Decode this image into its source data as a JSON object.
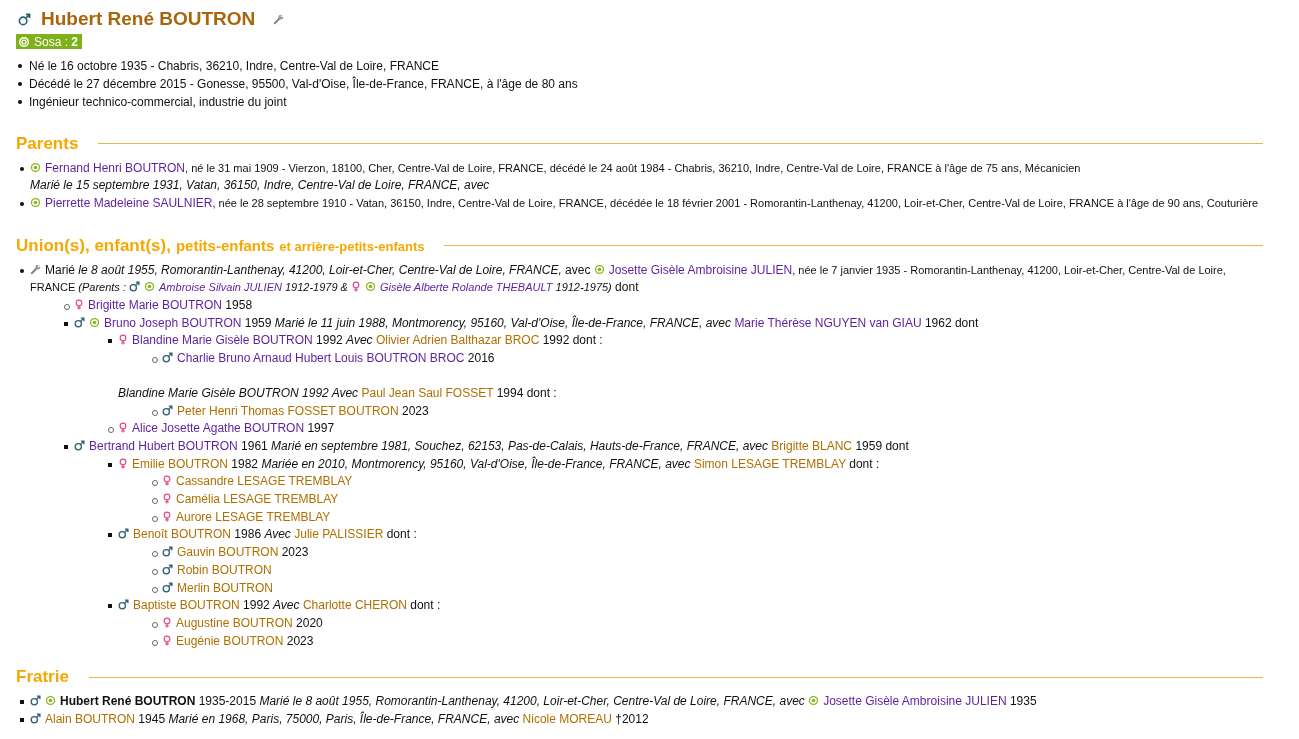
{
  "person": {
    "title": [
      {
        "kind": "male"
      },
      {
        "kind": "name",
        "text": "Hubert René BOUTRON"
      },
      {
        "kind": "tool"
      }
    ],
    "sosa": "Sosa : **2**",
    "facts": [
      "Né le 16 octobre 1935 - Chabris, 36210, Indre, Centre-Val de Loire, FRANCE",
      "Décédé le 27 décembre 2015 - Gonesse, 95500, Val-d'Oise, Île-de-France, FRANCE, à l'âge de 80 ans",
      "Ingénieur technico-commercial, industrie du joint"
    ]
  },
  "sections": [
    {
      "title_parts": [
        "Parents"
      ],
      "items": [
        {
          "kind": "disc",
          "segments": [
            {
              "kind": "sosa"
            },
            {
              "kind": "link",
              "text": "Fernand Henri BOUTRON"
            },
            {
              "kind": "detail",
              "text": ", né le 31 mai 1909 - Vierzon, 18100, Cher, Centre-Val de Loire, FRANCE, décédé le 24 août 1984 - Chabris, 36210, Indre, Centre-Val de Loire, FRANCE à l'âge de 75 ans, Mécanicien"
            }
          ],
          "blocks": [
            {
              "kind": "line",
              "segments": [
                {
                  "kind": "italic",
                  "text": "Marié le 15 septembre 1931, Vatan, 36150, Indre, Centre-Val de Loire, FRANCE, avec"
                }
              ]
            }
          ]
        },
        {
          "kind": "disc",
          "segments": [
            {
              "kind": "sosa"
            },
            {
              "kind": "link",
              "text": "Pierrette Madeleine SAULNIER"
            },
            {
              "kind": "detail",
              "text": ", née le 28 septembre 1910 - Vatan, 36150, Indre, Centre-Val de Loire, FRANCE, décédée le 18 février 2001 - Romorantin-Lanthenay, 41200, Loir-et-Cher, Centre-Val de Loire, FRANCE à l'âge de 90 ans, Couturière"
            }
          ]
        }
      ]
    },
    {
      "title_parts": [
        "Union(s), enfant(s),",
        "petits-enfants",
        "et arrière-petits-enfants"
      ],
      "items": [
        {
          "kind": "disc",
          "segments": [
            {
              "kind": "tool"
            },
            {
              "kind": "text",
              "text": "Marié"
            },
            {
              "kind": "italic",
              "text": " le 8 août 1955, Romorantin-Lanthenay, 41200, Loir-et-Cher, Centre-Val de Loire, FRANCE,"
            },
            {
              "kind": "text",
              "text": " avec "
            },
            {
              "kind": "sosa"
            },
            {
              "kind": "link",
              "text": "Josette Gisèle Ambroisine JULIEN"
            },
            {
              "kind": "detail",
              "text": ", née le 7 janvier 1935 - Romorantin-Lanthenay, 41200, Loir-et-Cher, Centre-Val de Loire,"
            }
          ],
          "blocks": [
            {
              "kind": "line",
              "segments": [
                {
                  "kind": "detail",
                  "text": "FRANCE"
                },
                {
                  "kind": "sitalic",
                  "text": " (Parents : "
                },
                {
                  "kind": "male"
                },
                {
                  "kind": "sosa"
                },
                {
                  "kind": "ilink",
                  "text": "Ambroise Silvain JULIEN"
                },
                {
                  "kind": "sitalic",
                  "text": " 1912-1979 & "
                },
                {
                  "kind": "female"
                },
                {
                  "kind": "sosa"
                },
                {
                  "kind": "ilink",
                  "text": "Gisèle Alberte Rolande THEBAULT"
                },
                {
                  "kind": "sitalic",
                  "text": " 1912-1975)"
                },
                {
                  "kind": "text",
                  "text": " dont"
                }
              ]
            },
            {
              "kind": "list",
              "children": [
                {
                  "kind": "circle",
                  "segments": [
                    {
                      "kind": "female"
                    },
                    {
                      "kind": "link",
                      "text": "Brigitte Marie BOUTRON"
                    },
                    {
                      "kind": "text",
                      "text": " 1958"
                    }
                  ]
                },
                {
                  "kind": "square",
                  "segments": [
                    {
                      "kind": "male"
                    },
                    {
                      "kind": "sosa"
                    },
                    {
                      "kind": "link",
                      "text": "Bruno Joseph BOUTRON"
                    },
                    {
                      "kind": "text",
                      "text": " 1959 "
                    },
                    {
                      "kind": "italic",
                      "text": " Marié le 11 juin 1988, Montmorency, 95160, Val-d'Oise, Île-de-France, FRANCE, avec "
                    },
                    {
                      "kind": "link",
                      "text": "Marie Thérèse NGUYEN van GIAU"
                    },
                    {
                      "kind": "text",
                      "text": " 1962 dont"
                    }
                  ],
                  "blocks": [
                    {
                      "kind": "list",
                      "children": [
                        {
                          "kind": "square",
                          "segments": [
                            {
                              "kind": "female"
                            },
                            {
                              "kind": "link",
                              "text": "Blandine Marie Gisèle BOUTRON"
                            },
                            {
                              "kind": "text",
                              "text": " 1992 "
                            },
                            {
                              "kind": "italic",
                              "text": "Avec "
                            },
                            {
                              "kind": "alink",
                              "text": "Olivier Adrien Balthazar BROC"
                            },
                            {
                              "kind": "text",
                              "text": " 1992 dont :"
                            }
                          ],
                          "blocks": [
                            {
                              "kind": "list",
                              "children": [
                                {
                                  "kind": "circle",
                                  "segments": [
                                    {
                                      "kind": "male"
                                    },
                                    {
                                      "kind": "link",
                                      "text": "Charlie Bruno Arnaud Hubert Louis BOUTRON BROC"
                                    },
                                    {
                                      "kind": "text",
                                      "text": " 2016"
                                    }
                                  ]
                                }
                              ]
                            },
                            {
                              "kind": "gap"
                            },
                            {
                              "kind": "line",
                              "segments": [
                                {
                                  "kind": "italic",
                                  "text": "Blandine Marie Gisèle BOUTRON 1992  Avec "
                                },
                                {
                                  "kind": "alink",
                                  "text": "Paul Jean Saul FOSSET"
                                },
                                {
                                  "kind": "text",
                                  "text": " 1994 dont :"
                                }
                              ]
                            },
                            {
                              "kind": "list",
                              "children": [
                                {
                                  "kind": "circle",
                                  "segments": [
                                    {
                                      "kind": "male"
                                    },
                                    {
                                      "kind": "alink",
                                      "text": "Peter Henri Thomas FOSSET BOUTRON"
                                    },
                                    {
                                      "kind": "text",
                                      "text": " 2023"
                                    }
                                  ]
                                }
                              ]
                            }
                          ]
                        },
                        {
                          "kind": "circle",
                          "segments": [
                            {
                              "kind": "female"
                            },
                            {
                              "kind": "link",
                              "text": "Alice Josette Agathe BOUTRON"
                            },
                            {
                              "kind": "text",
                              "text": " 1997"
                            }
                          ]
                        }
                      ]
                    }
                  ]
                },
                {
                  "kind": "square",
                  "segments": [
                    {
                      "kind": "male"
                    },
                    {
                      "kind": "link",
                      "text": "Bertrand Hubert BOUTRON"
                    },
                    {
                      "kind": "text",
                      "text": " 1961 "
                    },
                    {
                      "kind": "italic",
                      "text": " Marié en septembre 1981, Souchez, 62153, Pas-de-Calais, Hauts-de-France, FRANCE, avec "
                    },
                    {
                      "kind": "alink",
                      "text": "Brigitte BLANC"
                    },
                    {
                      "kind": "text",
                      "text": " 1959 dont"
                    }
                  ],
                  "blocks": [
                    {
                      "kind": "list",
                      "children": [
                        {
                          "kind": "square",
                          "segments": [
                            {
                              "kind": "female"
                            },
                            {
                              "kind": "alink",
                              "text": "Emilie BOUTRON"
                            },
                            {
                              "kind": "text",
                              "text": " 1982 "
                            },
                            {
                              "kind": "italic",
                              "text": "Mariée en 2010, Montmorency, 95160, Val-d'Oise, Île-de-France, FRANCE, avec "
                            },
                            {
                              "kind": "alink",
                              "text": "Simon LESAGE TREMBLAY"
                            },
                            {
                              "kind": "text",
                              "text": " dont :"
                            }
                          ],
                          "blocks": [
                            {
                              "kind": "list",
                              "children": [
                                {
                                  "kind": "circle",
                                  "segments": [
                                    {
                                      "kind": "female"
                                    },
                                    {
                                      "kind": "alink",
                                      "text": "Cassandre LESAGE TREMBLAY"
                                    }
                                  ]
                                },
                                {
                                  "kind": "circle",
                                  "segments": [
                                    {
                                      "kind": "female"
                                    },
                                    {
                                      "kind": "alink",
                                      "text": "Camélia LESAGE TREMBLAY"
                                    }
                                  ]
                                },
                                {
                                  "kind": "circle",
                                  "segments": [
                                    {
                                      "kind": "female"
                                    },
                                    {
                                      "kind": "alink",
                                      "text": "Aurore LESAGE TREMBLAY"
                                    }
                                  ]
                                }
                              ]
                            }
                          ]
                        },
                        {
                          "kind": "square",
                          "segments": [
                            {
                              "kind": "male"
                            },
                            {
                              "kind": "alink",
                              "text": "Benoît BOUTRON"
                            },
                            {
                              "kind": "text",
                              "text": " 1986 "
                            },
                            {
                              "kind": "italic",
                              "text": "Avec "
                            },
                            {
                              "kind": "alink",
                              "text": "Julie PALISSIER"
                            },
                            {
                              "kind": "text",
                              "text": " dont :"
                            }
                          ],
                          "blocks": [
                            {
                              "kind": "list",
                              "children": [
                                {
                                  "kind": "circle",
                                  "segments": [
                                    {
                                      "kind": "male"
                                    },
                                    {
                                      "kind": "alink",
                                      "text": "Gauvin BOUTRON"
                                    },
                                    {
                                      "kind": "text",
                                      "text": " 2023"
                                    }
                                  ]
                                },
                                {
                                  "kind": "circle",
                                  "segments": [
                                    {
                                      "kind": "male"
                                    },
                                    {
                                      "kind": "alink",
                                      "text": "Robin BOUTRON"
                                    }
                                  ]
                                },
                                {
                                  "kind": "circle",
                                  "segments": [
                                    {
                                      "kind": "male"
                                    },
                                    {
                                      "kind": "alink",
                                      "text": "Merlin BOUTRON"
                                    }
                                  ]
                                }
                              ]
                            }
                          ]
                        },
                        {
                          "kind": "square",
                          "segments": [
                            {
                              "kind": "male"
                            },
                            {
                              "kind": "alink",
                              "text": "Baptiste BOUTRON"
                            },
                            {
                              "kind": "text",
                              "text": " 1992 "
                            },
                            {
                              "kind": "italic",
                              "text": "Avec "
                            },
                            {
                              "kind": "alink",
                              "text": "Charlotte CHERON"
                            },
                            {
                              "kind": "text",
                              "text": " dont :"
                            }
                          ],
                          "blocks": [
                            {
                              "kind": "list",
                              "children": [
                                {
                                  "kind": "circle",
                                  "segments": [
                                    {
                                      "kind": "female"
                                    },
                                    {
                                      "kind": "alink",
                                      "text": "Augustine BOUTRON"
                                    },
                                    {
                                      "kind": "text",
                                      "text": " 2020"
                                    }
                                  ]
                                },
                                {
                                  "kind": "circle",
                                  "segments": [
                                    {
                                      "kind": "female"
                                    },
                                    {
                                      "kind": "alink",
                                      "text": "Eugénie BOUTRON"
                                    },
                                    {
                                      "kind": "text",
                                      "text": " 2023"
                                    }
                                  ]
                                }
                              ]
                            }
                          ]
                        }
                      ]
                    }
                  ]
                }
              ]
            }
          ]
        }
      ]
    },
    {
      "title_parts": [
        "Fratrie"
      ],
      "items": [
        {
          "kind": "square",
          "segments": [
            {
              "kind": "male"
            },
            {
              "kind": "sosa"
            },
            {
              "kind": "bold",
              "text": "Hubert René BOUTRON"
            },
            {
              "kind": "text",
              "text": " 1935-2015 "
            },
            {
              "kind": "italic",
              "text": "Marié le 8 août 1955, Romorantin-Lanthenay, 41200, Loir-et-Cher, Centre-Val de Loire, FRANCE, avec "
            },
            {
              "kind": "sosa"
            },
            {
              "kind": "link",
              "text": "Josette Gisèle Ambroisine JULIEN"
            },
            {
              "kind": "text",
              "text": " 1935"
            }
          ]
        },
        {
          "kind": "square",
          "segments": [
            {
              "kind": "male"
            },
            {
              "kind": "alink",
              "text": "Alain BOUTRON"
            },
            {
              "kind": "text",
              "text": " 1945 "
            },
            {
              "kind": "italic",
              "text": "Marié en 1968, Paris, 75000, Paris, Île-de-France, FRANCE, avec "
            },
            {
              "kind": "alink",
              "text": "Nicole MOREAU"
            },
            {
              "kind": "text",
              "text": " †2012"
            }
          ]
        }
      ]
    }
  ]
}
